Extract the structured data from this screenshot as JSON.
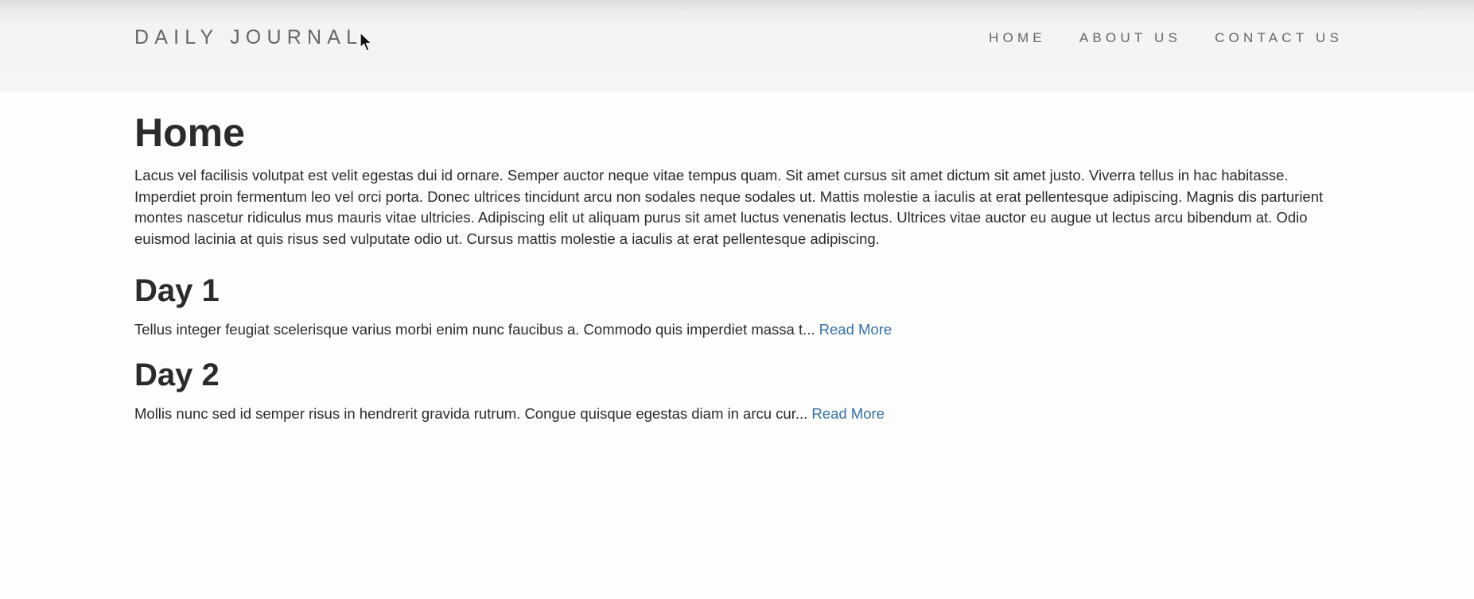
{
  "navbar": {
    "brand": "DAILY JOURNAL",
    "links": [
      {
        "label": "HOME"
      },
      {
        "label": "ABOUT US"
      },
      {
        "label": "CONTACT US"
      }
    ]
  },
  "main": {
    "title": "Home",
    "intro": "Lacus vel facilisis volutpat est velit egestas dui id ornare. Semper auctor neque vitae tempus quam. Sit amet cursus sit amet dictum sit amet justo. Viverra tellus in hac habitasse. Imperdiet proin fermentum leo vel orci porta. Donec ultrices tincidunt arcu non sodales neque sodales ut. Mattis molestie a iaculis at erat pellentesque adipiscing. Magnis dis parturient montes nascetur ridiculus mus mauris vitae ultricies. Adipiscing elit ut aliquam purus sit amet luctus venenatis lectus. Ultrices vitae auctor eu augue ut lectus arcu bibendum at. Odio euismod lacinia at quis risus sed vulputate odio ut. Cursus mattis molestie a iaculis at erat pellentesque adipiscing.",
    "posts": [
      {
        "title": "Day 1",
        "excerpt": "Tellus integer feugiat scelerisque varius morbi enim nunc faucibus a. Commodo quis imperdiet massa t...",
        "link_label": "Read More"
      },
      {
        "title": "Day 2",
        "excerpt": "Mollis nunc sed id semper risus in hendrerit gravida rutrum. Congue quisque egestas diam in arcu cur...",
        "link_label": "Read More"
      }
    ]
  },
  "colors": {
    "text": "#2b2b2b",
    "nav_text": "#666666",
    "link": "#3372a8",
    "navbar_bg": "#f6f5f6",
    "page_bg": "#fdfdfc"
  },
  "icons": {
    "cursor": "mouse-pointer-icon"
  }
}
